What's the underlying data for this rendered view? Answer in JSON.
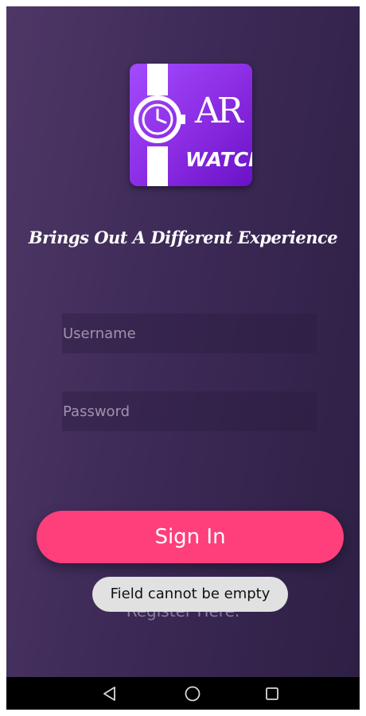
{
  "app": {
    "logo": {
      "mark_text": "AR",
      "subtitle": "WATCH",
      "colors": {
        "background": "#8a2be2",
        "foreground": "#ffffff"
      }
    },
    "tagline": "Brings Out A Different Experience"
  },
  "form": {
    "username": {
      "placeholder": "Username",
      "value": ""
    },
    "password": {
      "placeholder": "Password",
      "value": ""
    },
    "signin_label": "Sign In",
    "register_label": "Register Here."
  },
  "toast": {
    "message": "Field cannot be empty"
  },
  "navbar": {
    "icons": [
      "back-icon",
      "home-icon",
      "recents-icon"
    ]
  },
  "colors": {
    "background_start": "#4e3766",
    "background_end": "#2d1f44",
    "accent": "#fe3f7c",
    "toast_background": "#e1e1e1"
  }
}
